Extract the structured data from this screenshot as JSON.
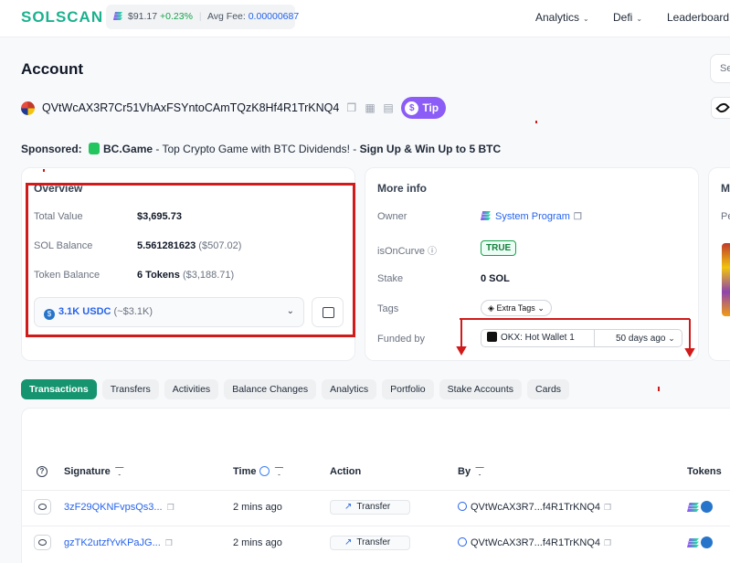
{
  "header": {
    "logo": "SOLSCAN",
    "price": "$91.17",
    "change": "+0.23%",
    "avg_fee_label": "Avg Fee:",
    "avg_fee": "0.00000687",
    "nav": [
      "Analytics",
      "Defi",
      "Leaderboard"
    ],
    "search_placeholder": "Se"
  },
  "page": {
    "title": "Account",
    "address": "QVtWcAX3R7Cr51VhAxFSYntoCAmTQzK8Hf4R1TrKNQ4",
    "tip_label": "Tip"
  },
  "sponsored": {
    "label": "Sponsored:",
    "brand": "BC.Game",
    "text": " - Top Crypto Game with BTC Dividends! - ",
    "cta": "Sign Up & Win Up to 5 BTC"
  },
  "overview": {
    "title": "Overview",
    "total_value_label": "Total Value",
    "total_value": "$3,695.73",
    "sol_balance_label": "SOL Balance",
    "sol_balance": "5.561281623",
    "sol_balance_usd": "($507.02)",
    "token_balance_label": "Token Balance",
    "token_balance": "6 Tokens",
    "token_balance_usd": "($3,188.71)",
    "token_select_value": "3.1K USDC",
    "token_select_usd": "(~$3.1K)"
  },
  "more_info": {
    "title": "More info",
    "owner_label": "Owner",
    "owner": "System Program",
    "oncurve_label": "isOnCurve",
    "oncurve": "TRUE",
    "stake_label": "Stake",
    "stake": "0 SOL",
    "tags_label": "Tags",
    "tags": "Extra Tags",
    "funded_label": "Funded by",
    "funded_by": "OKX: Hot Wallet 1",
    "funded_age": "50 days ago"
  },
  "third_card": {
    "title": "M",
    "label": "Pe"
  },
  "tabs": [
    "Transactions",
    "Transfers",
    "Activities",
    "Balance Changes",
    "Analytics",
    "Portfolio",
    "Stake Accounts",
    "Cards"
  ],
  "table": {
    "columns": [
      "Signature",
      "Time",
      "Action",
      "By",
      "Tokens"
    ],
    "rows": [
      {
        "signature": "3zF29QKNFvpsQs3...",
        "time": "2 mins ago",
        "action": "Transfer",
        "by": "QVtWcAX3R7...f4R1TrKNQ4"
      },
      {
        "signature": "gzTK2utzfYvKPaJG...",
        "time": "2 mins ago",
        "action": "Transfer",
        "by": "QVtWcAX3R7...f4R1TrKNQ4"
      }
    ]
  },
  "colors": {
    "brand": "#1bb18e",
    "link": "#2563eb",
    "tip": "#8b5cf6",
    "annotation": "#d11a1a"
  }
}
